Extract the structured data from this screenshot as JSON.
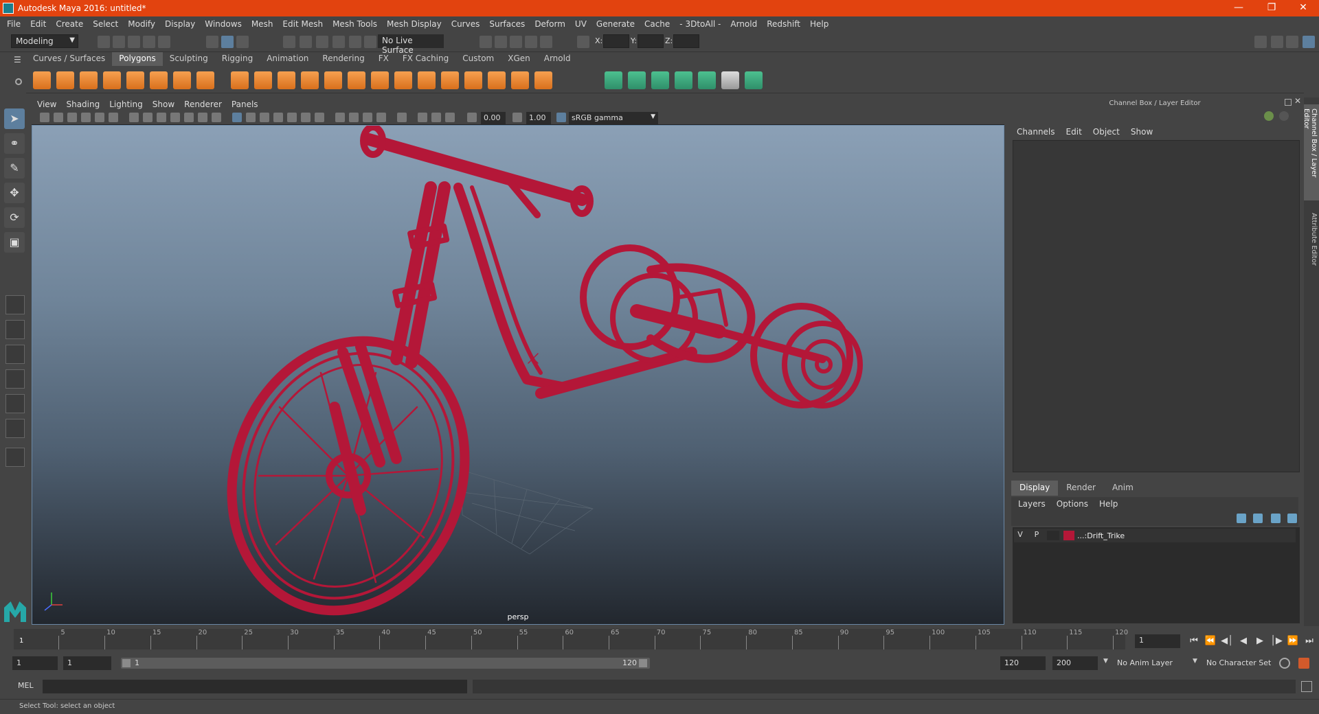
{
  "window": {
    "title": "Autodesk Maya 2016: untitled*"
  },
  "menubar": [
    "File",
    "Edit",
    "Create",
    "Select",
    "Modify",
    "Display",
    "Windows",
    "Mesh",
    "Edit Mesh",
    "Mesh Tools",
    "Mesh Display",
    "Curves",
    "Surfaces",
    "Deform",
    "UV",
    "Generate",
    "Cache",
    "- 3DtoAll -",
    "Arnold",
    "Redshift",
    "Help"
  ],
  "statusline": {
    "mode": "Modeling",
    "live_surface": "No Live Surface",
    "x_label": "X:",
    "y_label": "Y:",
    "z_label": "Z:"
  },
  "shelf": {
    "tabs": [
      "Curves / Surfaces",
      "Polygons",
      "Sculpting",
      "Rigging",
      "Animation",
      "Rendering",
      "FX",
      "FX Caching",
      "Custom",
      "XGen",
      "Arnold"
    ],
    "active": "Polygons"
  },
  "viewport": {
    "menu": [
      "View",
      "Shading",
      "Lighting",
      "Show",
      "Renderer",
      "Panels"
    ],
    "exposure": "0.00",
    "gamma": "1.00",
    "color_space": "sRGB gamma",
    "camera_label": "persp",
    "wire_color": "#b41738"
  },
  "channelbox": {
    "title": "Channel Box / Layer Editor",
    "menu": [
      "Channels",
      "Edit",
      "Object",
      "Show"
    ],
    "side_tabs": [
      "Channel Box / Layer Editor",
      "Attribute Editor"
    ]
  },
  "layers": {
    "tabs": [
      "Display",
      "Render",
      "Anim"
    ],
    "active_tab": "Display",
    "menu": [
      "Layers",
      "Options",
      "Help"
    ],
    "rows": [
      {
        "v": "V",
        "p": "P",
        "name": "...:Drift_Trike",
        "color": "#b41738"
      }
    ]
  },
  "timeline": {
    "labels": [
      "5",
      "10",
      "15",
      "20",
      "25",
      "30",
      "35",
      "40",
      "45",
      "50",
      "55",
      "60",
      "65",
      "70",
      "75",
      "80",
      "85",
      "90",
      "95",
      "100",
      "105",
      "110",
      "115",
      "120"
    ],
    "start_marker": "1",
    "current_frame": "1"
  },
  "range": {
    "start": "1",
    "inner_start": "1",
    "slider_start": "1",
    "slider_end": "120",
    "end": "120",
    "max_end": "200",
    "anim_layer": "No Anim Layer",
    "character_set": "No Character Set"
  },
  "cmdline": {
    "label": "MEL"
  },
  "helpline": {
    "text": "Select Tool: select an object"
  }
}
